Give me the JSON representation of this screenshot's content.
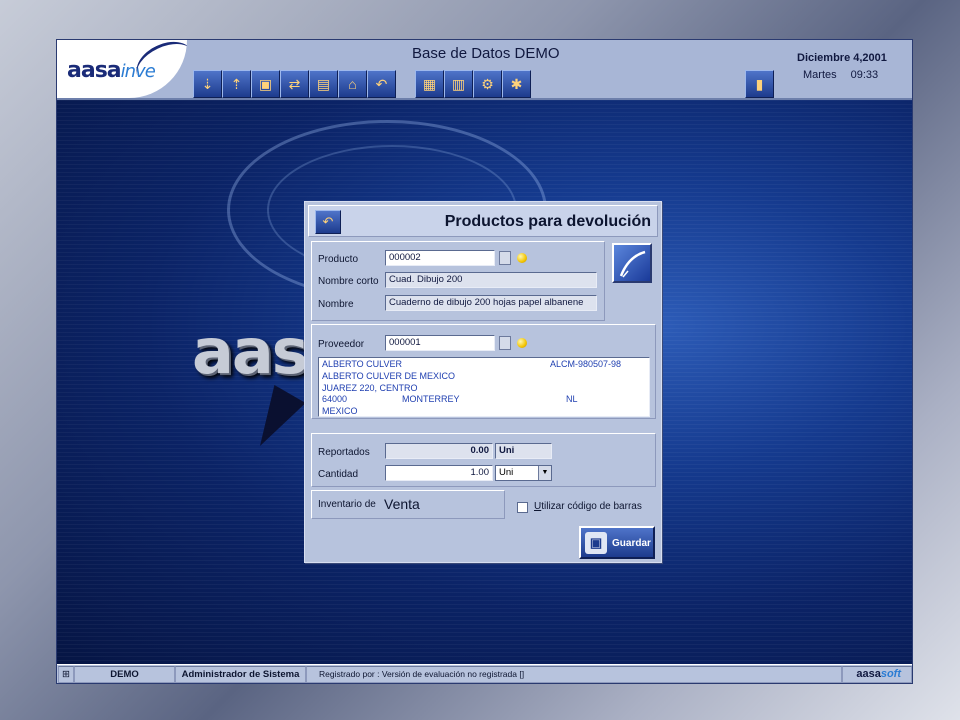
{
  "header": {
    "logo_main": "aasa",
    "logo_accent": "inve",
    "title": "Base de Datos DEMO",
    "date": "Diciembre 4,2001",
    "day": "Martes",
    "time": "09:33",
    "toolbar_group_1": [
      "entry-icon",
      "exit-arrow-icon",
      "boxes-icon",
      "transfer-icon",
      "shelf-icon",
      "warehouse-icon",
      "return-icon"
    ],
    "toolbar_group_2": [
      "documents-icon",
      "books-icon",
      "settings-icon",
      "config-icon"
    ],
    "exit_icon": "door-exit-icon"
  },
  "background": {
    "logo_text": "aasa"
  },
  "dialog": {
    "title": "Productos para devolución",
    "producto": {
      "label": "Producto",
      "value": "000002",
      "short_name_label": "Nombre corto",
      "short_name": "Cuad. Dibujo 200",
      "name_label": "Nombre",
      "name": "Cuaderno de dibujo 200 hojas papel albanene"
    },
    "proveedor": {
      "label": "Proveedor",
      "value": "000001",
      "lines": [
        {
          "col1": "ALBERTO CULVER",
          "col2": "",
          "col3": "ALCM-980507-98"
        },
        {
          "col1": "ALBERTO CULVER DE MEXICO",
          "col2": "",
          "col3": ""
        },
        {
          "col1": "JUAREZ 220, CENTRO",
          "col2": "",
          "col3": ""
        },
        {
          "col1": "64000",
          "col2": "MONTERREY",
          "col3": "NL"
        },
        {
          "col1": "MEXICO",
          "col2": "",
          "col3": ""
        }
      ]
    },
    "reportados": {
      "label": "Reportados",
      "value": "0.00",
      "unit": "Uni"
    },
    "cantidad": {
      "label": "Cantidad",
      "value": "1.00",
      "unit": "Uni"
    },
    "inventario": {
      "label": "Inventario de",
      "value": "Venta"
    },
    "barcode": {
      "label_prefix": "U",
      "label_rest": "tilizar código de barras",
      "checked": false
    },
    "save_label": "Guardar"
  },
  "statusbar": {
    "database": "DEMO",
    "user": "Administrador de Sistema",
    "registered": "Registrado por : Versión de evaluación no registrada  []",
    "brand_main": "aasa",
    "brand_accent": "soft"
  },
  "colors": {
    "header_bg": "#a8b6d6",
    "dialog_bg": "#b7c3dd",
    "tool_button": "#1d3b8d",
    "vendor_text": "#1f3fb0"
  }
}
